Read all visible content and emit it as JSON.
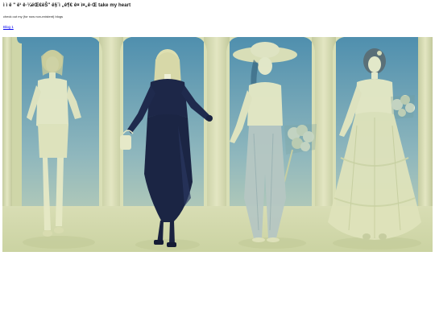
{
  "page": {
    "title": "ì   ì    ë     \" ë¹    ê·¼ëŒ€ëŠ\" ë§¨ì „ê¶€ ê¤ ì¤„ê·Œ take my heart",
    "intro": "check out my (for now non-existent) blogs",
    "links": [
      {
        "label": "Blog 1"
      }
    ]
  },
  "banner": {
    "figures": [
      {
        "name": "figure-1",
        "outfit": "light-dress"
      },
      {
        "name": "figure-2",
        "outfit": "dark-dress"
      },
      {
        "name": "figure-3",
        "outfit": "hat-and-bouquet"
      },
      {
        "name": "figure-4",
        "outfit": "ball-gown"
      }
    ],
    "colors": {
      "sky_top": "#4f8fae",
      "sky_bottom": "#a9c7c6",
      "arch": "#d7ddb4",
      "floor": "#d2d8ac",
      "dark_dress": "#1d2748",
      "light_figure": "#e8ecc8",
      "hair": "#c6c698"
    }
  }
}
